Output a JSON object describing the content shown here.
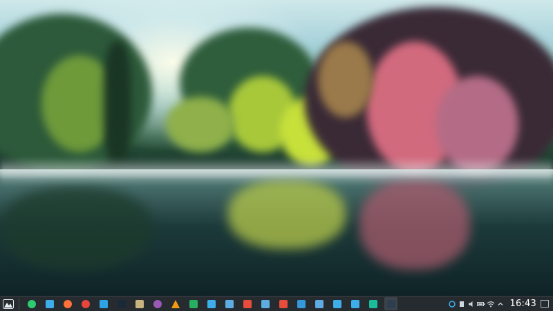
{
  "desktop": {
    "wallpaper": "lake-forest-reflection",
    "colors": {
      "taskbar_bg": "#262b30",
      "accent": "#3daee9"
    }
  },
  "taskbar": {
    "launcher_icon": "mountain-logo-icon",
    "apps": [
      {
        "id": "system-settings",
        "icon": "gear-circle-icon",
        "color": "#2ecc71"
      },
      {
        "id": "file-manager",
        "icon": "folder-icon",
        "color": "#3daee9"
      },
      {
        "id": "firefox",
        "icon": "firefox-icon",
        "color": "#ff7139"
      },
      {
        "id": "chrome",
        "icon": "chrome-icon",
        "color": "#e8453c"
      },
      {
        "id": "telegram",
        "icon": "paper-plane-icon",
        "color": "#2fa3e6"
      },
      {
        "id": "steam",
        "icon": "steam-icon",
        "color": "#1b2838"
      },
      {
        "id": "game-launcher",
        "icon": "gamepad-icon",
        "color": "#c9b37e"
      },
      {
        "id": "media",
        "icon": "swirl-icon",
        "color": "#9b59b6"
      },
      {
        "id": "vlc",
        "icon": "vlc-cone-icon",
        "color": "#f39c12"
      },
      {
        "id": "spreadsheet",
        "icon": "spreadsheet-icon",
        "color": "#27ae60"
      },
      {
        "id": "presentation",
        "icon": "slides-icon",
        "color": "#3daee9"
      },
      {
        "id": "document-viewer",
        "icon": "document-icon",
        "color": "#5dade2"
      },
      {
        "id": "pdf-reader",
        "icon": "pdf-icon",
        "color": "#e74c3c"
      },
      {
        "id": "text-doc",
        "icon": "text-document-icon",
        "color": "#5dade2"
      },
      {
        "id": "office-doc",
        "icon": "office-doc-icon",
        "color": "#e74c3c"
      },
      {
        "id": "writer",
        "icon": "writer-icon",
        "color": "#3498db"
      },
      {
        "id": "clipboard",
        "icon": "clipboard-icon",
        "color": "#5dade2"
      },
      {
        "id": "image-viewer",
        "icon": "image-icon",
        "color": "#3daee9"
      },
      {
        "id": "screenshot",
        "icon": "camera-icon",
        "color": "#3daee9"
      },
      {
        "id": "downloader",
        "icon": "download-icon",
        "color": "#1abc9c"
      },
      {
        "id": "terminal",
        "icon": "terminal-icon",
        "color": "#2c3e50"
      }
    ],
    "active_app": "terminal"
  },
  "tray": {
    "icons": [
      "network-share-icon",
      "storage-icon",
      "volume-icon",
      "battery-icon",
      "wifi-icon",
      "chevron-up-icon"
    ],
    "clock": "16:43",
    "show_desktop_icon": "show-desktop-icon"
  }
}
